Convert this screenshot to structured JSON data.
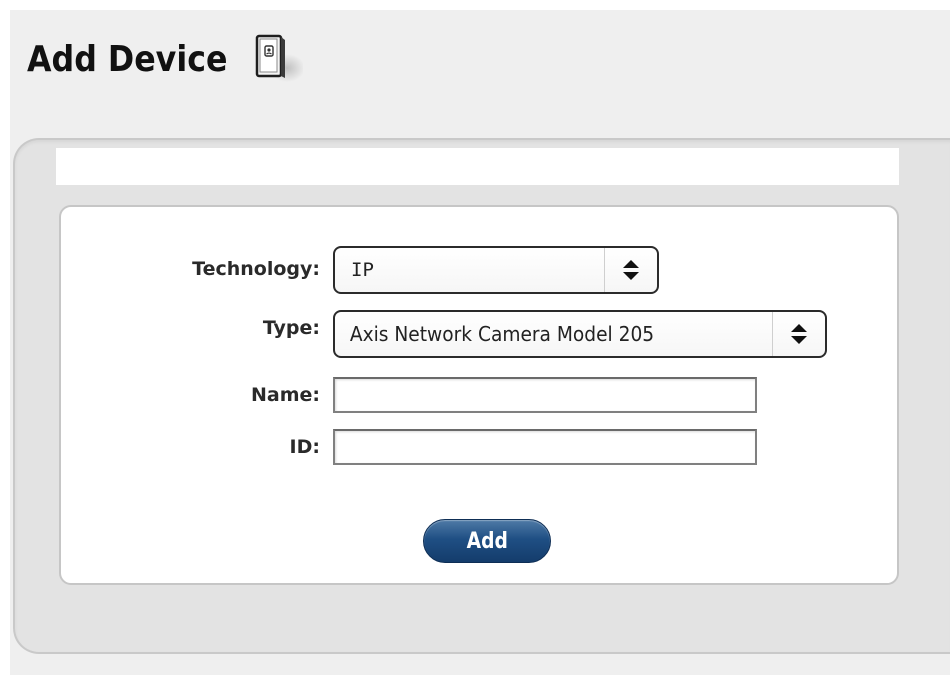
{
  "header": {
    "title": "Add Device",
    "icon": "device-icon"
  },
  "form": {
    "technology": {
      "label": "Technology:",
      "value": "IP"
    },
    "type": {
      "label": "Type:",
      "value": "Axis Network Camera Model 205"
    },
    "name": {
      "label": "Name:",
      "value": ""
    },
    "id": {
      "label": "ID:",
      "value": ""
    },
    "submit_label": "Add"
  },
  "colors": {
    "button": "#1f4f84",
    "background": "#efefef",
    "panel": "#e3e3e3"
  }
}
